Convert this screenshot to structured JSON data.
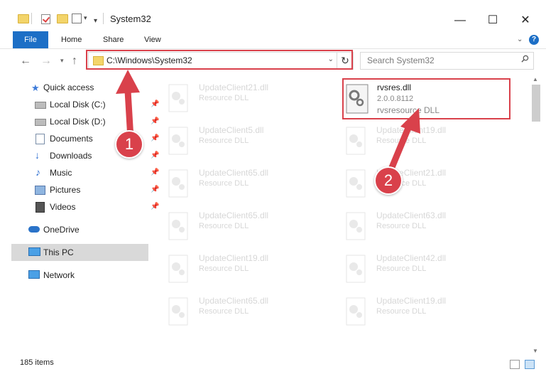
{
  "window": {
    "title": "System32",
    "minimize": "—",
    "maximize": "☐",
    "close": "✕"
  },
  "ribbon": {
    "tabs": [
      "File",
      "Home",
      "Share",
      "View"
    ],
    "help": "?"
  },
  "address": {
    "path": "C:\\Windows\\System32",
    "search_placeholder": "Search System32"
  },
  "sidebar": {
    "items": [
      {
        "label": "Quick access",
        "icon": "star-icon",
        "pinned": false
      },
      {
        "label": "Local Disk (C:)",
        "icon": "drive-icon",
        "pinned": true
      },
      {
        "label": "Local Disk (D:)",
        "icon": "drive-icon",
        "pinned": true
      },
      {
        "label": "Documents",
        "icon": "documents-icon",
        "pinned": true
      },
      {
        "label": "Downloads",
        "icon": "download-icon",
        "pinned": true
      },
      {
        "label": "Music",
        "icon": "music-icon",
        "pinned": true
      },
      {
        "label": "Pictures",
        "icon": "pictures-icon",
        "pinned": true
      },
      {
        "label": "Videos",
        "icon": "videos-icon",
        "pinned": true
      },
      {
        "label": "OneDrive",
        "icon": "cloud-icon",
        "pinned": false
      },
      {
        "label": "This PC",
        "icon": "computer-icon",
        "pinned": false,
        "selected": true
      },
      {
        "label": "Network",
        "icon": "network-icon",
        "pinned": false
      }
    ]
  },
  "files": [
    {
      "name": "UpdateClient21.dll",
      "type": "Resource DLL"
    },
    {
      "name": "rvsres.dll",
      "version": "2.0.0.8112",
      "type": "rvsresource DLL",
      "highlighted": true
    },
    {
      "name": "UpdateClient5.dll",
      "type": "Resource DLL"
    },
    {
      "name": "UpdateClient19.dll",
      "type": "Resource DLL"
    },
    {
      "name": "UpdateClient65.dll",
      "type": "Resource DLL"
    },
    {
      "name": "UpdateClient21.dll",
      "type": "Resource DLL"
    },
    {
      "name": "UpdateClient65.dll",
      "type": "Resource DLL"
    },
    {
      "name": "UpdateClient63.dll",
      "type": "Resource DLL"
    },
    {
      "name": "UpdateClient19.dll",
      "type": "Resource DLL"
    },
    {
      "name": "UpdateClient42.dll",
      "type": "Resource DLL"
    },
    {
      "name": "UpdateClient65.dll",
      "type": "Resource DLL"
    },
    {
      "name": "UpdateClient19.dll",
      "type": "Resource DLL"
    }
  ],
  "status": {
    "item_count": "185 items"
  },
  "annotations": {
    "step1": "1",
    "step2": "2",
    "color": "#d9414b"
  }
}
